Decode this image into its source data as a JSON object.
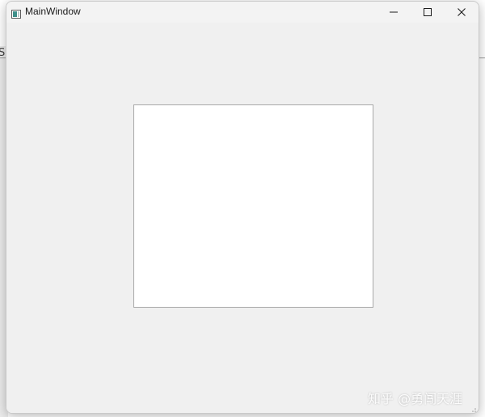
{
  "window": {
    "title": "MainWindow",
    "controls": {
      "minimize": "minimize",
      "maximize": "maximize",
      "close": "close"
    },
    "icon": "window-app-icon"
  },
  "background": {
    "glyph": "S"
  },
  "client": {
    "panel": "blank-white-panel"
  },
  "watermark": {
    "text": "知乎 @勇闯天涯"
  },
  "colors": {
    "window_bg": "#f0f0f0",
    "titlebar_bg": "#f3f3f3",
    "panel_bg": "#ffffff",
    "panel_border": "#a8a8a8",
    "title_text": "#1b1b1b"
  }
}
